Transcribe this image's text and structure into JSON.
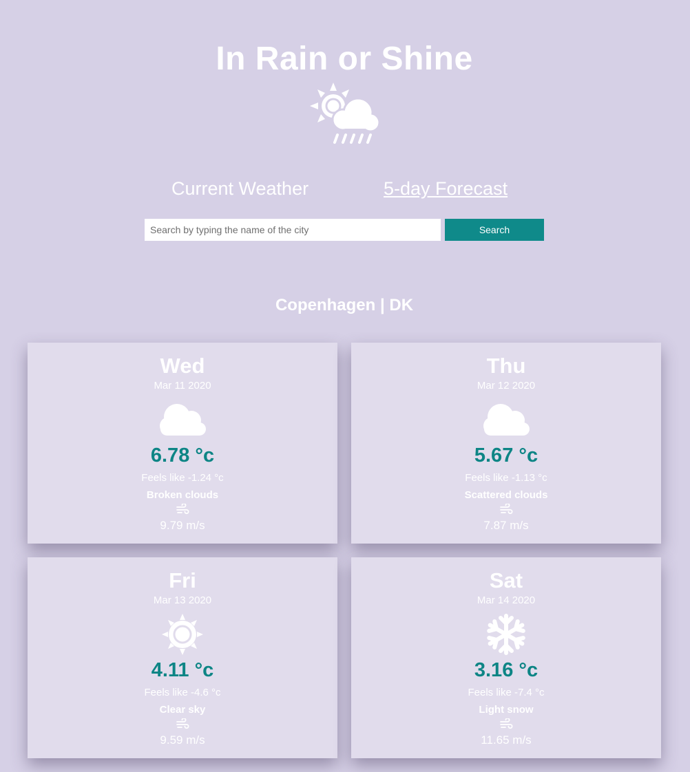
{
  "header": {
    "title": "In Rain or Shine",
    "logo_icon": "sun-cloud-rain-icon"
  },
  "nav": {
    "current": "Current Weather",
    "forecast": "5-day Forecast"
  },
  "search": {
    "placeholder": "Search by typing the name of the city",
    "value": "",
    "button": "Search"
  },
  "city": "Copenhagen | DK",
  "colors": {
    "background": "#d6d0e6",
    "card": "#e1dcec",
    "accent": "#0f8a8a",
    "text": "#ffffff"
  },
  "forecast": [
    {
      "day": "Wed",
      "date": "Mar 11 2020",
      "icon": "cloud-icon",
      "temp": "6.78 °c",
      "feels": "Feels like -1.24 °c",
      "description": "Broken clouds",
      "wind_icon": "wind-icon",
      "wind": "9.79 m/s"
    },
    {
      "day": "Thu",
      "date": "Mar 12 2020",
      "icon": "cloud-icon",
      "temp": "5.67 °c",
      "feels": "Feels like -1.13 °c",
      "description": "Scattered clouds",
      "wind_icon": "wind-icon",
      "wind": "7.87 m/s"
    },
    {
      "day": "Fri",
      "date": "Mar 13 2020",
      "icon": "sun-icon",
      "temp": "4.11 °c",
      "feels": "Feels like -4.6 °c",
      "description": "Clear sky",
      "wind_icon": "wind-icon",
      "wind": "9.59 m/s"
    },
    {
      "day": "Sat",
      "date": "Mar 14 2020",
      "icon": "snowflake-icon",
      "temp": "3.16 °c",
      "feels": "Feels like -7.4 °c",
      "description": "Light snow",
      "wind_icon": "wind-icon",
      "wind": "11.65 m/s"
    }
  ]
}
